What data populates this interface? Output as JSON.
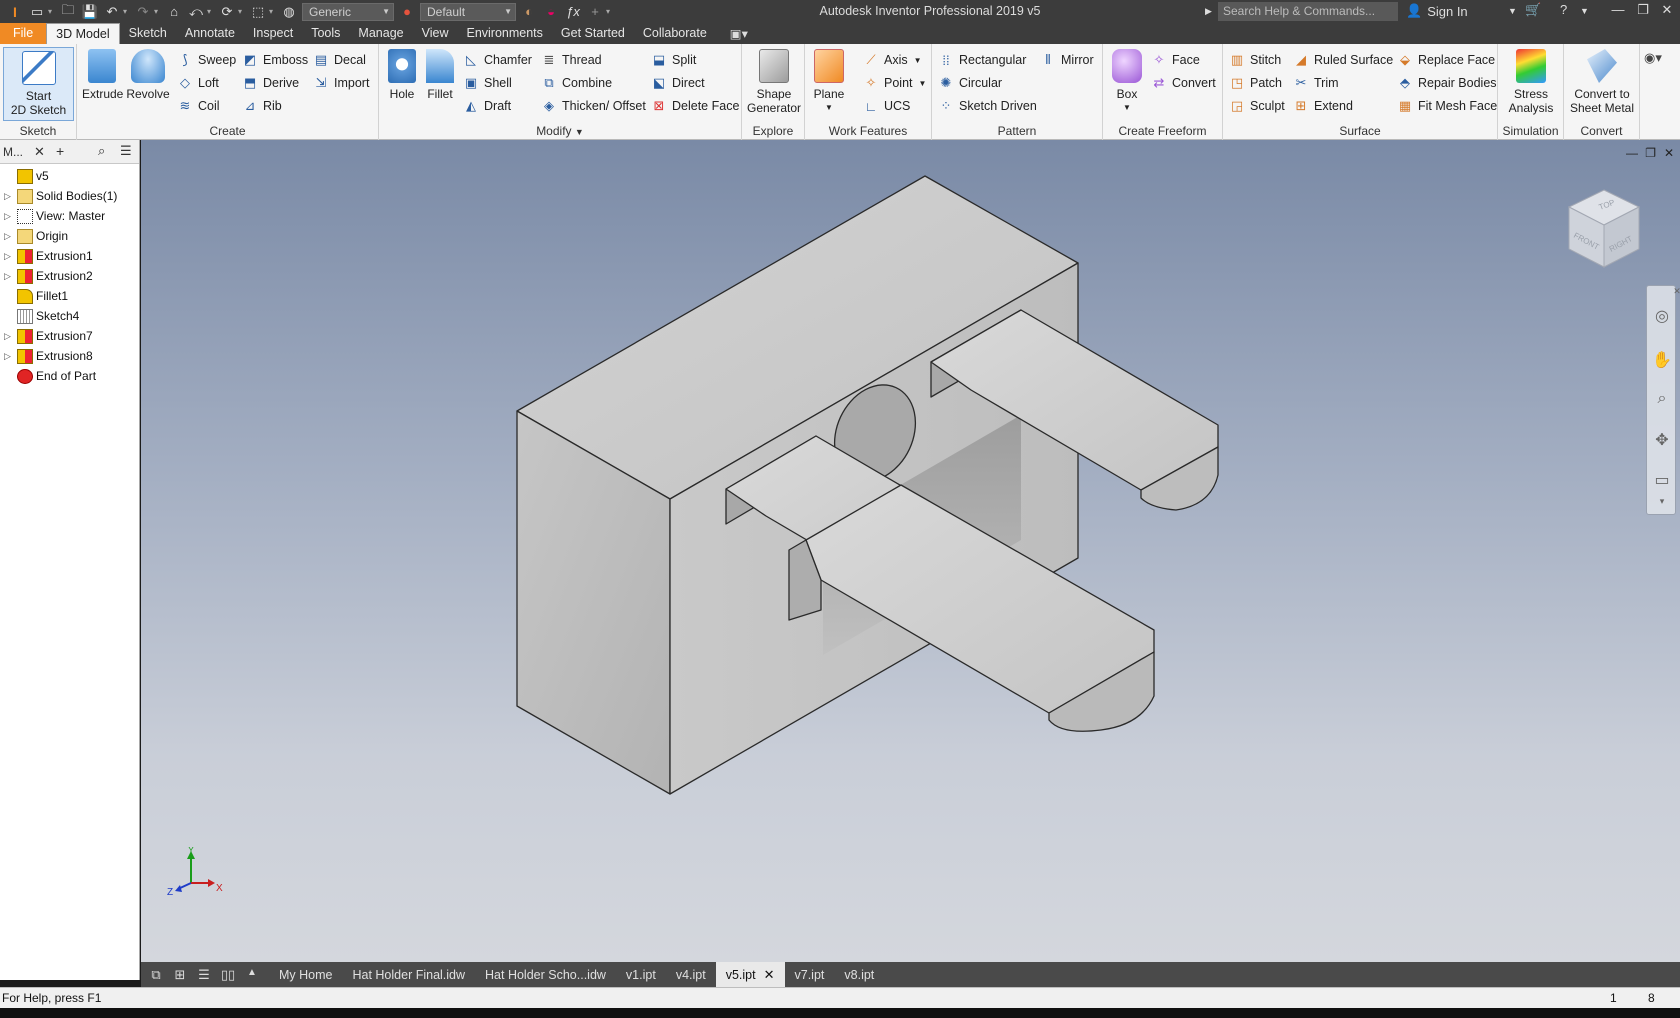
{
  "titlebar": {
    "title": "Autodesk Inventor Professional 2019    v5",
    "material": "Generic",
    "appearance": "Default",
    "search_placeholder": "Search Help & Commands...",
    "sign_in": "Sign In"
  },
  "ribbon_tabs": [
    "File",
    "3D Model",
    "Sketch",
    "Annotate",
    "Inspect",
    "Tools",
    "Manage",
    "View",
    "Environments",
    "Get Started",
    "Collaborate"
  ],
  "ribbon": {
    "sketch": {
      "label": "Sketch",
      "start_sketch": "Start",
      "start_sketch2": "2D Sketch"
    },
    "create": {
      "label": "Create",
      "extrude": "Extrude",
      "revolve": "Revolve",
      "sweep": "Sweep",
      "loft": "Loft",
      "coil": "Coil",
      "emboss": "Emboss",
      "derive": "Derive",
      "rib": "Rib",
      "decal": "Decal",
      "import": "Import"
    },
    "modify": {
      "label": "Modify",
      "hole": "Hole",
      "fillet": "Fillet",
      "chamfer": "Chamfer",
      "shell": "Shell",
      "draft": "Draft",
      "thread": "Thread",
      "combine": "Combine",
      "thicken": "Thicken/ Offset",
      "split": "Split",
      "direct": "Direct",
      "delete_face": "Delete Face"
    },
    "explore": {
      "label": "Explore",
      "shape_gen": "Shape",
      "shape_gen2": "Generator"
    },
    "work": {
      "label": "Work Features",
      "plane": "Plane",
      "axis": "Axis",
      "point": "Point",
      "ucs": "UCS"
    },
    "pattern": {
      "label": "Pattern",
      "rectangular": "Rectangular",
      "circular": "Circular",
      "sketch_driven": "Sketch Driven",
      "mirror": "Mirror"
    },
    "freeform": {
      "label": "Create Freeform",
      "box": "Box",
      "face": "Face",
      "convert": "Convert"
    },
    "surface": {
      "label": "Surface",
      "stitch": "Stitch",
      "patch": "Patch",
      "sculpt": "Sculpt",
      "ruled": "Ruled Surface",
      "trim": "Trim",
      "extend": "Extend",
      "replace_face": "Replace Face",
      "repair": "Repair Bodies",
      "fit_mesh": "Fit Mesh Face"
    },
    "simulation": {
      "label": "Simulation",
      "stress": "Stress",
      "stress2": "Analysis"
    },
    "convert": {
      "label": "Convert",
      "sheet": "Convert to",
      "sheet2": "Sheet Metal"
    }
  },
  "browser": {
    "title": "M...",
    "items": [
      {
        "label": "v5",
        "icon": "part-icon"
      },
      {
        "label": "Solid Bodies(1)",
        "icon": "folder-icon"
      },
      {
        "label": "View: Master",
        "icon": "view-icon"
      },
      {
        "label": "Origin",
        "icon": "folder-icon"
      },
      {
        "label": "Extrusion1",
        "icon": "extrude-icon"
      },
      {
        "label": "Extrusion2",
        "icon": "extrude-icon"
      },
      {
        "label": "Fillet1",
        "icon": "fillet-icon"
      },
      {
        "label": "Sketch4",
        "icon": "sketch-icon"
      },
      {
        "label": "Extrusion7",
        "icon": "extrude-icon"
      },
      {
        "label": "Extrusion8",
        "icon": "extrude-icon"
      },
      {
        "label": "End of Part",
        "icon": "end-of-part-icon"
      }
    ]
  },
  "viewcube": {
    "top": "TOP",
    "front": "FRONT",
    "right": "RIGHT"
  },
  "triad": {
    "x": "X",
    "y": "Y",
    "z": "Z"
  },
  "doc_tabs": [
    "My Home",
    "Hat Holder Final.idw",
    "Hat Holder Scho...idw",
    "v1.ipt",
    "v4.ipt",
    "v5.ipt",
    "v7.ipt",
    "v8.ipt"
  ],
  "active_doc": "v5.ipt",
  "status": {
    "help": "For Help, press F1",
    "count1": "1",
    "count2": "8"
  }
}
